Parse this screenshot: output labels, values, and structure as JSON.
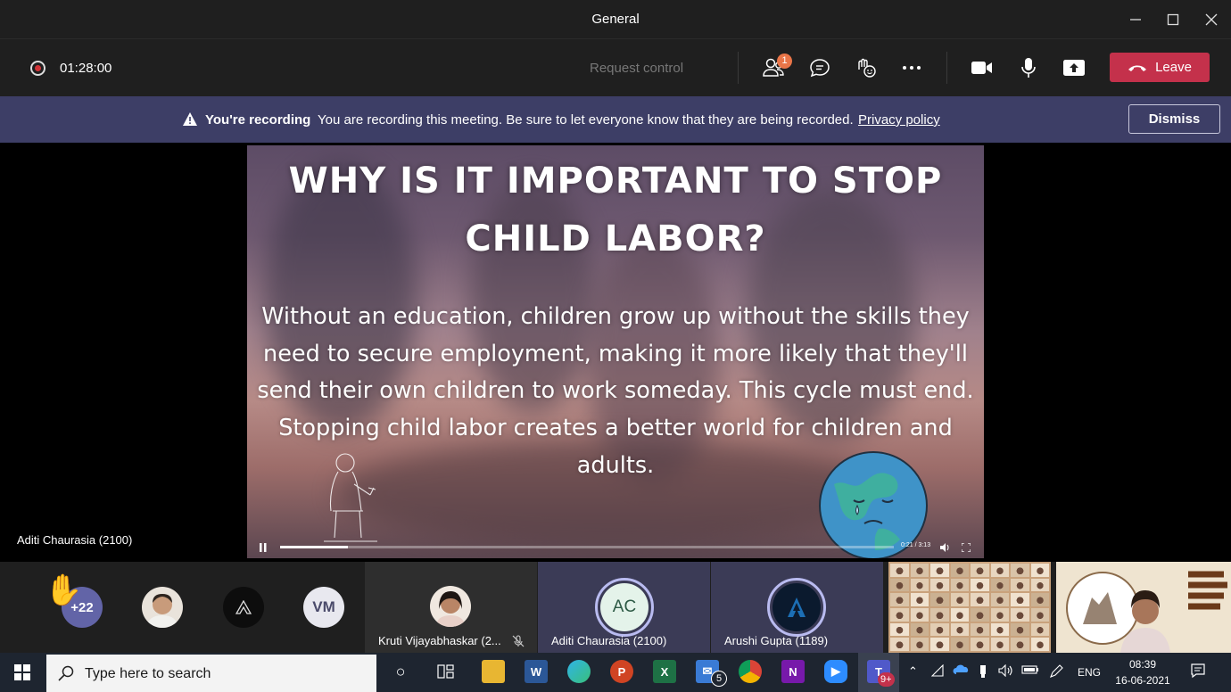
{
  "window": {
    "title": "General"
  },
  "meeting": {
    "elapsed": "01:28:00",
    "request_control": "Request control",
    "participants_badge": "1",
    "leave_label": "Leave"
  },
  "recording_banner": {
    "title": "You're recording",
    "message": "You are recording this meeting. Be sure to let everyone know that they are being recorded.",
    "link": "Privacy policy",
    "dismiss": "Dismiss"
  },
  "slide": {
    "heading": "WHY IS IT IMPORTANT TO STOP CHILD LABOR?",
    "body": "Without an education, children grow up without the skills they need to secure employment, making it more likely that they'll send their own children to work someday. This cycle must end. Stopping child labor creates a better world for children and adults.",
    "video_time": "0:21 / 3:13",
    "video_progress": 0.11
  },
  "speaker_name": "Aditi Chaurasia (2100)",
  "gallery": {
    "overflow_count": "+22",
    "avatar_initials": "VM",
    "tiles": [
      {
        "name": "Kruti Vijayabhaskar (2..."
      },
      {
        "name": "Aditi Chaurasia (2100)",
        "initials": "AC"
      },
      {
        "name": "Arushi Gupta (1189)"
      }
    ]
  },
  "taskbar": {
    "search_placeholder": "Type here to search",
    "mail_badge": "5",
    "teams_badge": "9+",
    "language": "ENG",
    "time": "08:39",
    "date": "16-06-2021"
  },
  "colors": {
    "leave": "#c4314b",
    "banner": "#3d3e66",
    "record": "#d13438",
    "accent": "#6264a7"
  }
}
